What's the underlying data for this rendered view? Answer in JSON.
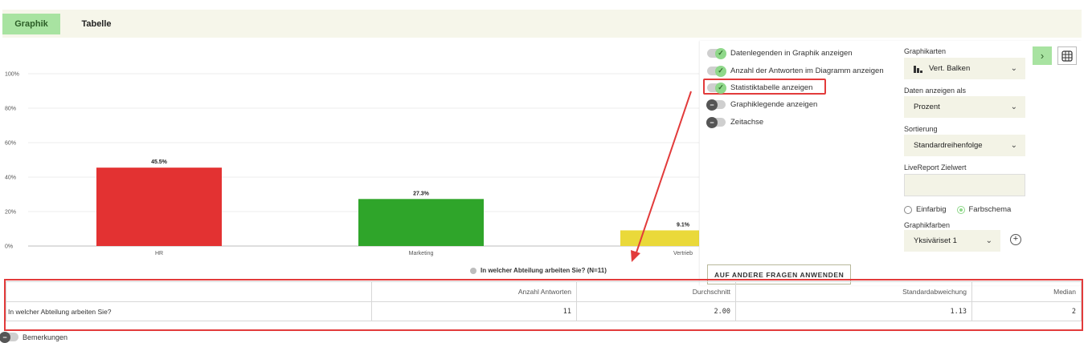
{
  "tabs": [
    {
      "label": "Graphik",
      "active": true
    },
    {
      "label": "Tabelle",
      "active": false
    }
  ],
  "chart_data": {
    "type": "bar",
    "categories": [
      "HR",
      "Marketing",
      "Vertrieb"
    ],
    "values": [
      45.5,
      27.3,
      9.1
    ],
    "value_labels": [
      "45.5%",
      "27.3%",
      "9.1%"
    ],
    "colors": [
      "#e33232",
      "#2fa52a",
      "#ead93a"
    ],
    "ylim": [
      0,
      100
    ],
    "yticks": [
      0,
      20,
      40,
      60,
      80,
      100
    ],
    "ytick_labels": [
      "0%",
      "20%",
      "40%",
      "60%",
      "80%",
      "100%"
    ],
    "grid": true,
    "legend": {
      "label": "In welcher Abteilung arbeiten Sie? (N=11)",
      "placement": "bottom"
    }
  },
  "settings": {
    "toggles": [
      {
        "label": "Datenlegenden in Graphik anzeigen",
        "on": true
      },
      {
        "label": "Anzahl der Antworten im Diagramm anzeigen",
        "on": true
      },
      {
        "label": "Statistiktabelle anzeigen",
        "on": true
      },
      {
        "label": "Graphiklegende anzeigen",
        "on": false
      },
      {
        "label": "Zeitachse",
        "on": false
      }
    ],
    "chart_type_label": "Graphikarten",
    "chart_type_value": "Vert. Balken",
    "display_label": "Daten anzeigen als",
    "display_value": "Prozent",
    "sort_label": "Sortierung",
    "sort_value": "Standardreihenfolge",
    "target_label": "LiveReport Zielwert",
    "target_value": "",
    "radio_single": "Einfarbig",
    "radio_scheme": "Farbschema",
    "colors_label": "Graphikfarben",
    "colors_value": "Yksiväriset 1",
    "apply_button": "AUF ANDERE FRAGEN ANWENDEN"
  },
  "stats_table": {
    "headers": [
      "",
      "Anzahl Antworten",
      "Durchschnitt",
      "Standardabweichung",
      "Median"
    ],
    "rows": [
      {
        "question": "In welcher Abteilung arbeiten Sie?",
        "count": "11",
        "mean": "2.00",
        "sd": "1.13",
        "median": "2"
      }
    ]
  },
  "remarks_label": "Bemerkungen"
}
